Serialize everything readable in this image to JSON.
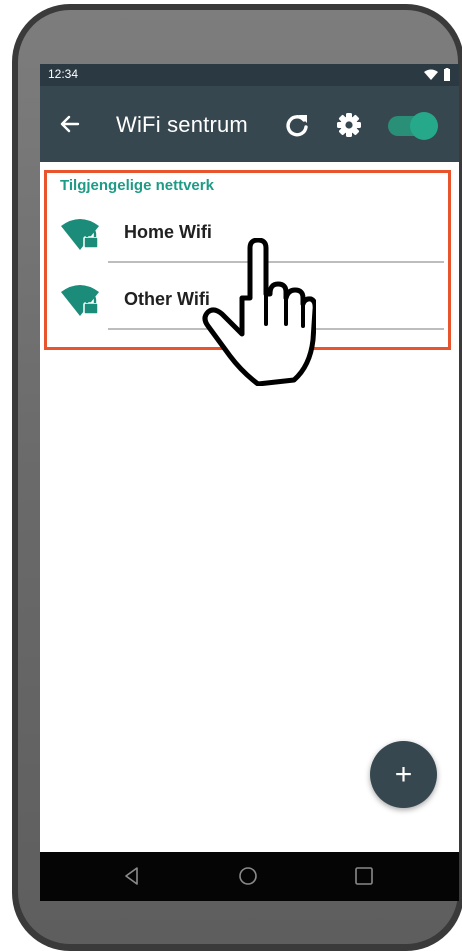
{
  "status_bar": {
    "time": "12:34"
  },
  "app_bar": {
    "title": "WiFi sentrum"
  },
  "section": {
    "title": "Tilgjengelige nettverk"
  },
  "networks": [
    {
      "label": "Home Wifi"
    },
    {
      "label": "Other Wifi"
    }
  ],
  "fab": {
    "label": "+"
  },
  "colors": {
    "app_bar": "#37474f",
    "status_bar": "#2b3a42",
    "accent": "#1e9b86",
    "highlight": "#e8542c"
  },
  "icons": [
    "back-arrow-icon",
    "refresh-icon",
    "settings-gear-icon",
    "wifi-lock-icon",
    "hand-pointer-icon",
    "nav-back-icon",
    "nav-home-icon",
    "nav-recents-icon"
  ]
}
